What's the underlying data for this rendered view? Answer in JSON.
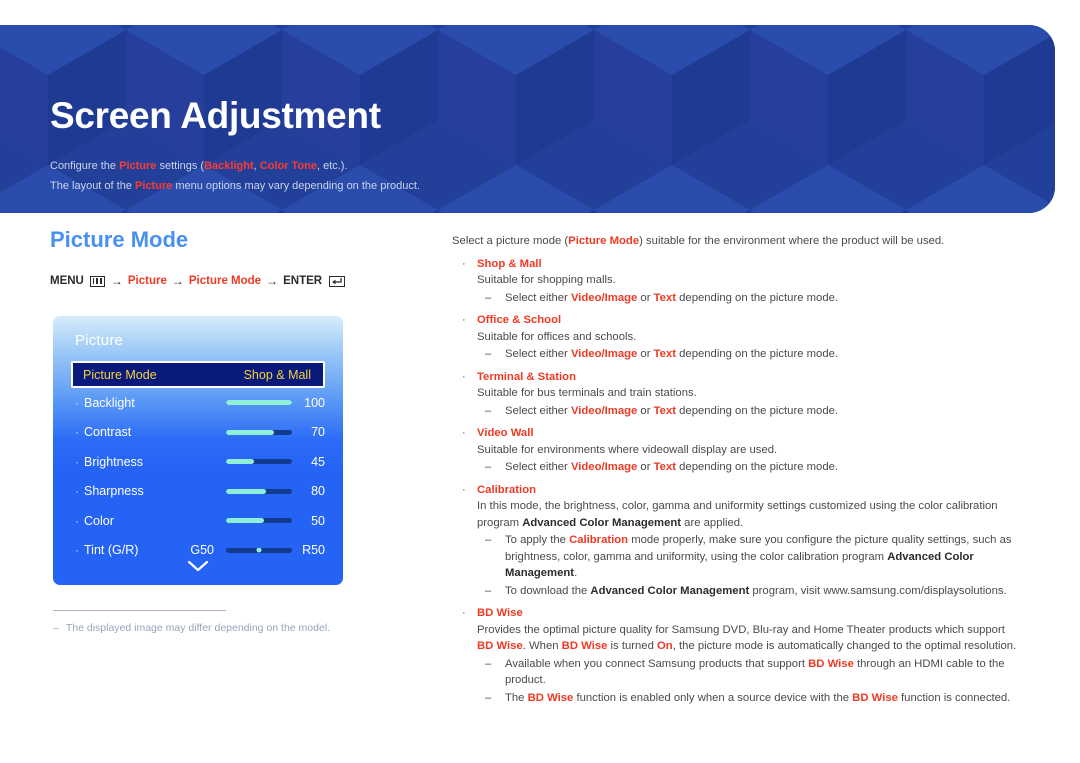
{
  "banner": {
    "title": "Screen Adjustment",
    "line1": {
      "pre": "Configure the ",
      "hl1": "Picture",
      "mid": " settings (",
      "hl2": "Backlight",
      "sep": ", ",
      "hl3": "Color Tone",
      "post": ", etc.)."
    },
    "line2": {
      "pre": "The layout of the ",
      "hl1": "Picture",
      "post": " menu options may vary depending on the product."
    }
  },
  "left": {
    "section_title": "Picture Mode",
    "menu_path": {
      "menu_label": "MENU",
      "menu_icon": "menu-grid-icon",
      "arrow": "→",
      "step1": "Picture",
      "step2": "Picture Mode",
      "enter_label": "ENTER",
      "enter_icon": "enter-key-icon"
    },
    "footnote": {
      "dash": "–",
      "text": "The displayed image may differ depending on the model."
    }
  },
  "osd": {
    "title": "Picture",
    "chevron_icon": "chevron-down-icon",
    "selected_row": {
      "label": "Picture Mode",
      "value": "Shop & Mall"
    },
    "rows": [
      {
        "bullet": "·",
        "label": "Backlight",
        "value": "100",
        "fill_pct": 100,
        "type": "slider"
      },
      {
        "bullet": "·",
        "label": "Contrast",
        "value": "70",
        "fill_pct": 72,
        "type": "slider"
      },
      {
        "bullet": "·",
        "label": "Brightness",
        "value": "45",
        "fill_pct": 42,
        "type": "slider"
      },
      {
        "bullet": "·",
        "label": "Sharpness",
        "value": "80",
        "fill_pct": 60,
        "type": "slider"
      },
      {
        "bullet": "·",
        "label": "Color",
        "value": "50",
        "fill_pct": 58,
        "type": "slider"
      },
      {
        "bullet": "·",
        "label": "Tint (G/R)",
        "left_label": "G50",
        "right_label": "R50",
        "type": "dot"
      }
    ]
  },
  "right": {
    "intro": {
      "pre": "Select a picture mode (",
      "hl": "Picture Mode",
      "post": ") suitable for the environment where the product will be used."
    },
    "select_note": {
      "pre": "Select either ",
      "hl1": "Video/Image",
      "mid": " or ",
      "hl2": "Text",
      "post": " depending on the picture mode."
    },
    "items": [
      {
        "title": "Shop & Mall",
        "desc": "Suitable for shopping malls."
      },
      {
        "title": "Office & School",
        "desc": "Suitable for offices and schools."
      },
      {
        "title": "Terminal & Station",
        "desc": "Suitable for bus terminals and train stations."
      },
      {
        "title": "Video Wall",
        "desc": "Suitable for environments where videowall display are used."
      }
    ],
    "calibration": {
      "title": "Calibration",
      "desc_pre": "In this mode, the brightness, color, gamma and uniformity settings customized using the color calibration program ",
      "desc_bold": "Advanced Color Management",
      "desc_post": " are applied.",
      "sub1_pre": "To apply the ",
      "sub1_red": "Calibration",
      "sub1_mid": " mode properly, make sure you configure the picture quality settings, such as brightness, color, gamma and uniformity, using the color calibration program ",
      "sub1_bold": "Advanced Color Management",
      "sub1_post": ".",
      "sub2_pre": "To download the ",
      "sub2_bold": "Advanced Color Management",
      "sub2_post": " program, visit www.samsung.com/displaysolutions."
    },
    "bdwise": {
      "title": "BD Wise",
      "desc_pre": "Provides the optimal picture quality for Samsung DVD, Blu-ray and Home Theater products which support ",
      "desc_red1": "BD Wise",
      "desc_mid": ". When ",
      "desc_red2": "BD Wise",
      "desc_mid2": " is turned ",
      "desc_red3": "On",
      "desc_post": ", the picture mode is automatically changed to the optimal resolution.",
      "sub1_pre": "Available when you connect Samsung products that support ",
      "sub1_red": "BD Wise",
      "sub1_post": " through an HDMI cable to the product.",
      "sub2_pre": "The ",
      "sub2_red1": "BD Wise",
      "sub2_mid": " function is enabled only when a source device with the ",
      "sub2_red2": "BD Wise",
      "sub2_post": " function is connected."
    },
    "dash": "–",
    "bullet": "·"
  },
  "colors": {
    "banner_bg": "#22409a",
    "accent_red": "#ee3a24",
    "section_blue": "#4a90f0",
    "osd_blue": "#2563f5",
    "osd_selected_bg": "#0a1a7a",
    "osd_selected_text": "#f5d142",
    "slider_fill": "#8ef0d8"
  }
}
